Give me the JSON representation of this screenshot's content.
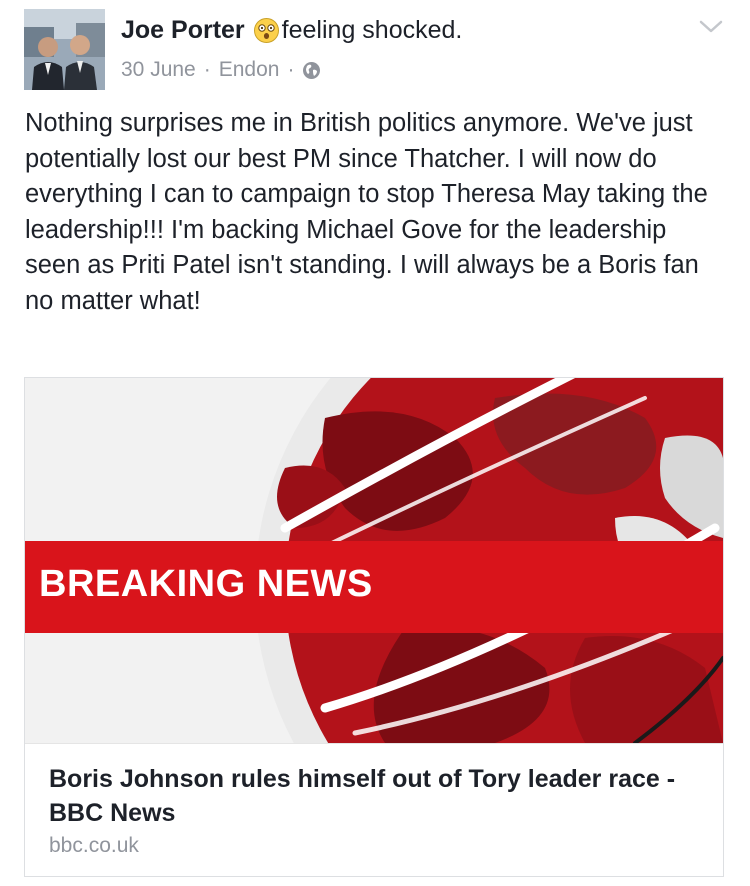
{
  "post": {
    "author": "Joe Porter",
    "feeling": "feeling shocked.",
    "date": "30 June",
    "location": "Endon",
    "separator": "·",
    "privacy_icon": "globe-icon",
    "text": "Nothing surprises me in British politics anymore. We've just potentially lost our best PM since Thatcher. I will now do everything I can to campaign to stop Theresa May taking the leadership!!! I'm backing Michael Gove for the leadership seen as Priti Patel isn't standing. I will always be a Boris fan no matter what!"
  },
  "link_preview": {
    "banner_text": "BREAKING NEWS",
    "title": "Boris Johnson rules himself out of Tory leader race - BBC News",
    "domain": "bbc.co.uk"
  },
  "icons": {
    "feeling": "shocked-face-icon",
    "menu": "chevron-down-icon"
  },
  "colors": {
    "text": "#1d2129",
    "meta": "#90949c",
    "banner": "#d9141b",
    "globe_dark": "#8c1a1f"
  }
}
